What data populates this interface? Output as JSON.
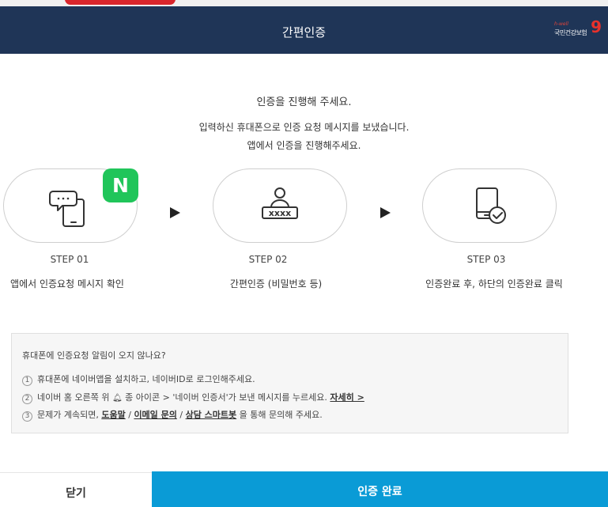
{
  "header": {
    "title": "간편인증",
    "logo_small": "h-well",
    "logo_text": "국민건강보험"
  },
  "intro": {
    "line1": "인증을 진행해 주세요.",
    "line2": "입력하신 휴대폰으로 인증 요청 메시지를 보냈습니다.",
    "line3": "앱에서 인증을 진행해주세요."
  },
  "steps": [
    {
      "number": "STEP 01",
      "desc": "앱에서 인증요청 메시지 확인",
      "icon": "phone-message-icon",
      "badge": "N"
    },
    {
      "number": "STEP 02",
      "desc": "간편인증 (비밀번호 등)",
      "icon": "user-password-icon"
    },
    {
      "number": "STEP 03",
      "desc": "인증완료 후, 하단의 인증완료 클릭",
      "icon": "phone-check-icon"
    }
  ],
  "help": {
    "title": "휴대폰에 인증요청 알림이 오지 않나요?",
    "item1": {
      "num": "1",
      "text": "휴대폰에 네이버앱을 설치하고, 네이버ID로 로그인해주세요."
    },
    "item2": {
      "num": "2",
      "pre": "네이버 홈 오른쪽 위",
      "post": "종 아이콘 > '네이버 인증서'가 보낸 메시지를 누르세요.",
      "link": "자세히 >"
    },
    "item3": {
      "num": "3",
      "pre": "문제가 계속되면,",
      "link1": "도움말",
      "sep1": "/",
      "link2": "이메일 문의",
      "sep2": "/",
      "link3": "상담 스마트봇",
      "post": "을 통해 문의해 주세요."
    }
  },
  "footer": {
    "close_label": "닫기",
    "done_label": "인증 완료"
  },
  "colors": {
    "header_bg": "#1f3557",
    "done_bg": "#0a9bd6",
    "naver_green": "#20c55a"
  }
}
